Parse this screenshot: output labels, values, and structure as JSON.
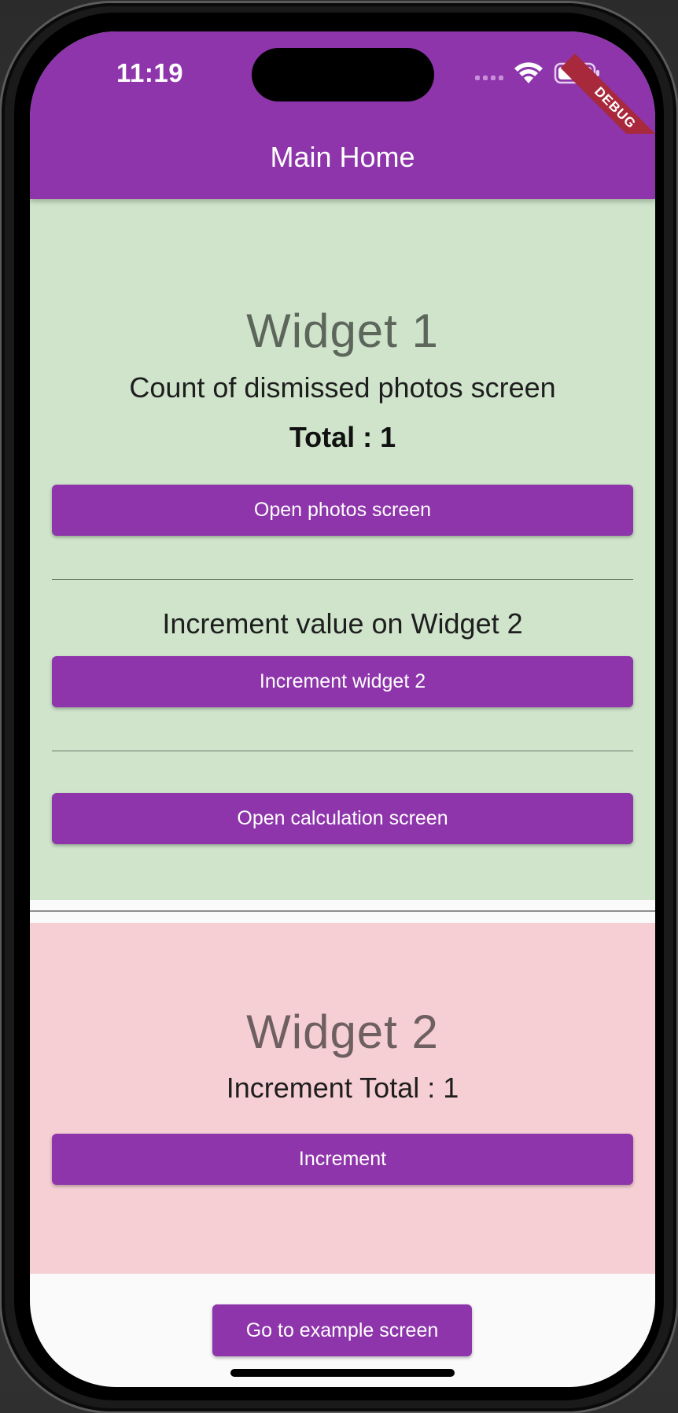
{
  "status_bar": {
    "time": "11:19"
  },
  "app_bar": {
    "title": "Main Home",
    "debug_banner": "DEBUG",
    "color": "#8e35ab"
  },
  "widget1": {
    "heading": "Widget 1",
    "dismissed_label": "Count of dismissed photos screen",
    "total_text": "Total : 1",
    "open_photos_button": "Open photos screen",
    "increment_label": "Increment value on Widget 2",
    "increment_widget2_button": "Increment widget 2",
    "open_calculation_button": "Open calculation screen",
    "background": "#cfe4cb"
  },
  "widget2": {
    "heading": "Widget 2",
    "total_text": "Increment Total : 1",
    "increment_button": "Increment",
    "background": "#f6cfd4"
  },
  "footer": {
    "example_button": "Go to example screen"
  },
  "icons": [
    "cellular-signal-icon",
    "wifi-icon",
    "battery-icon"
  ]
}
